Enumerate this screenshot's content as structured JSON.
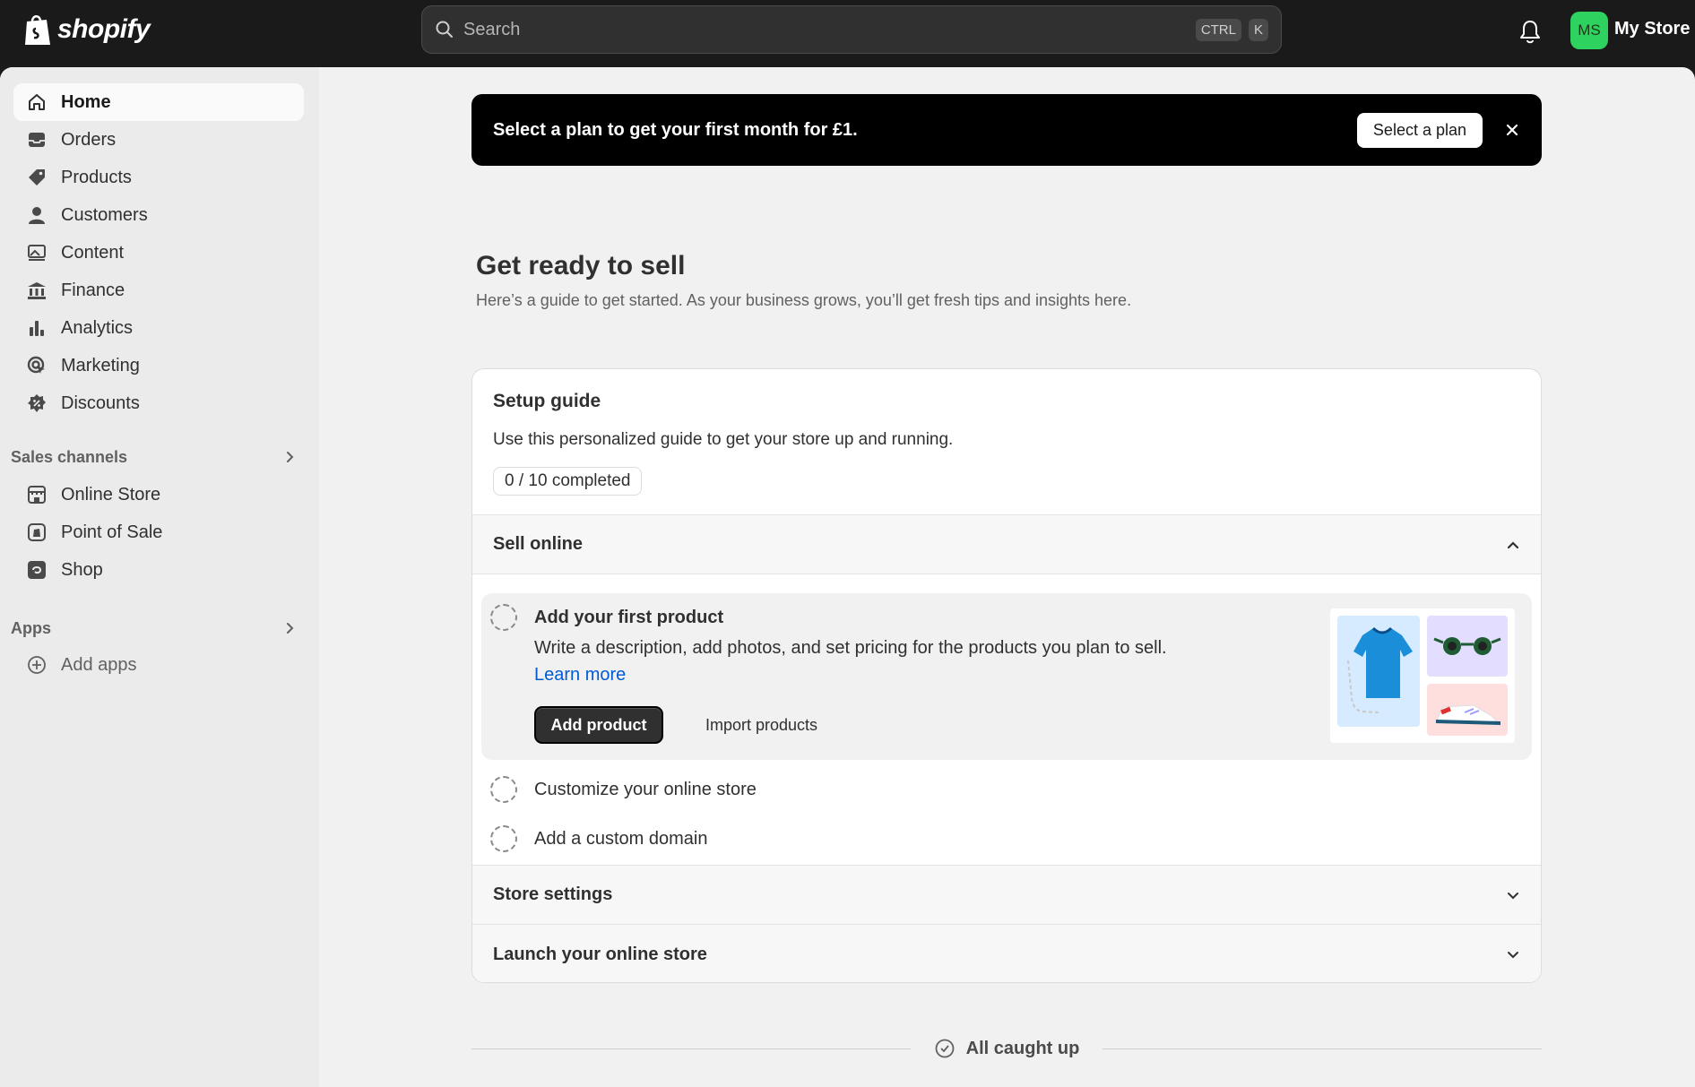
{
  "topbar": {
    "logo_text": "shopify",
    "search_placeholder": "Search",
    "kbd_ctrl": "CTRL",
    "kbd_k": "K",
    "avatar_initials": "MS",
    "store_name": "My Store",
    "avatar_color": "#2ed35f"
  },
  "sidebar": {
    "items": [
      {
        "label": "Home",
        "icon": "home-icon"
      },
      {
        "label": "Orders",
        "icon": "inbox-icon"
      },
      {
        "label": "Products",
        "icon": "tag-icon"
      },
      {
        "label": "Customers",
        "icon": "person-icon"
      },
      {
        "label": "Content",
        "icon": "content-icon"
      },
      {
        "label": "Finance",
        "icon": "bank-icon"
      },
      {
        "label": "Analytics",
        "icon": "bar-chart-icon"
      },
      {
        "label": "Marketing",
        "icon": "target-icon"
      },
      {
        "label": "Discounts",
        "icon": "discount-icon"
      }
    ],
    "sales_channels_header": "Sales channels",
    "sales_channels": [
      {
        "label": "Online Store",
        "icon": "storefront-icon"
      },
      {
        "label": "Point of Sale",
        "icon": "pos-icon"
      },
      {
        "label": "Shop",
        "icon": "shop-icon"
      }
    ],
    "apps_header": "Apps",
    "add_apps": "Add apps"
  },
  "banner": {
    "text": "Select a plan to get your first month for £1.",
    "button": "Select a plan"
  },
  "main": {
    "title": "Get ready to sell",
    "subtitle": "Here’s a guide to get started. As your business grows, you’ll get fresh tips and insights here."
  },
  "setup_guide": {
    "title": "Setup guide",
    "description": "Use this personalized guide to get your store up and running.",
    "progress": "0 / 10 completed",
    "sections": [
      {
        "title": "Sell online",
        "expanded": true
      },
      {
        "title": "Store settings",
        "expanded": false
      },
      {
        "title": "Launch your online store",
        "expanded": false
      }
    ],
    "expanded_task": {
      "title": "Add your first product",
      "description": "Write a description, add photos, and set pricing for the products you plan to sell.",
      "link": "Learn more",
      "primary_button": "Add product",
      "secondary_button": "Import products"
    },
    "tasks": [
      "Customize your online store",
      "Add a custom domain"
    ]
  },
  "footer": {
    "caught_up": "All caught up"
  }
}
